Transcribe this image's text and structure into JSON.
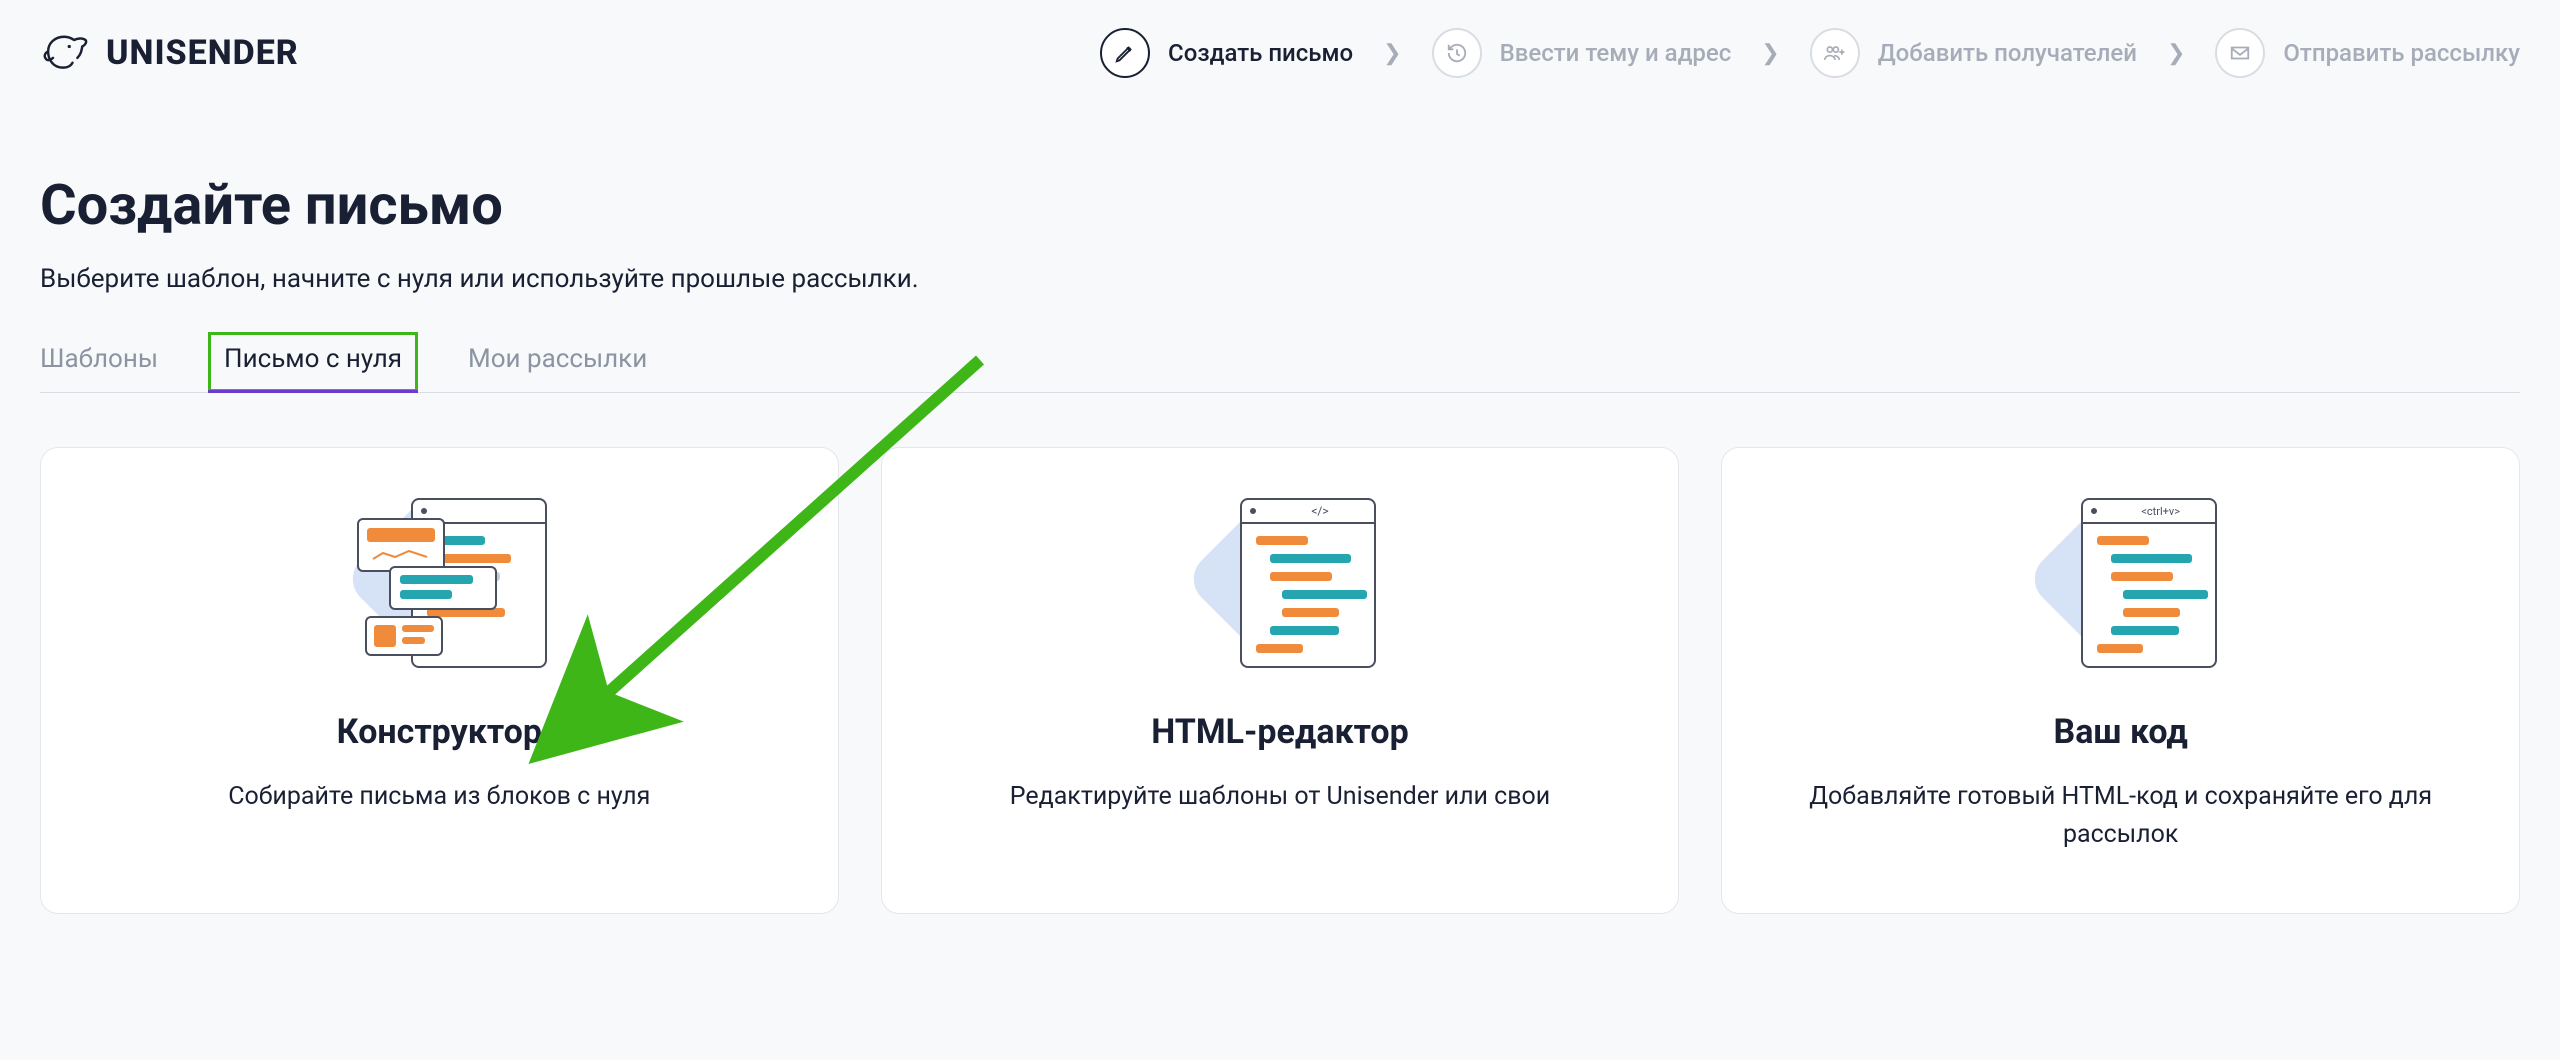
{
  "brand": "UNISENDER",
  "stepper": [
    {
      "label": "Создать письмо",
      "active": true,
      "icon": "pencil"
    },
    {
      "label": "Ввести тему и адрес",
      "active": false,
      "icon": "history"
    },
    {
      "label": "Добавить получателей",
      "active": false,
      "icon": "users-plus"
    },
    {
      "label": "Отправить рассылку",
      "active": false,
      "icon": "envelope"
    }
  ],
  "page": {
    "title": "Создайте письмо",
    "subtitle": "Выберите шаблон, начните с нуля или используйте прошлые рассылки."
  },
  "tabs": [
    {
      "label": "Шаблоны",
      "active": false,
      "highlight": false
    },
    {
      "label": "Письмо с нуля",
      "active": true,
      "highlight": true
    },
    {
      "label": "Мои рассылки",
      "active": false,
      "highlight": false
    }
  ],
  "cards": [
    {
      "title": "Конструктор",
      "desc": "Собирайте письма из блоков с нуля"
    },
    {
      "title": "HTML-редактор",
      "desc": "Редактируйте шаблоны от Unisender или свои"
    },
    {
      "title": "Ваш код",
      "desc": "Добавляйте готовый HTML-код и сохраняйте его для рассылок"
    }
  ],
  "illus": {
    "html_tag": "</>",
    "ctrlv": "<ctrl+v>"
  },
  "annotation": {
    "arrow_color": "#3fb618",
    "highlight_color": "#3fb618"
  }
}
